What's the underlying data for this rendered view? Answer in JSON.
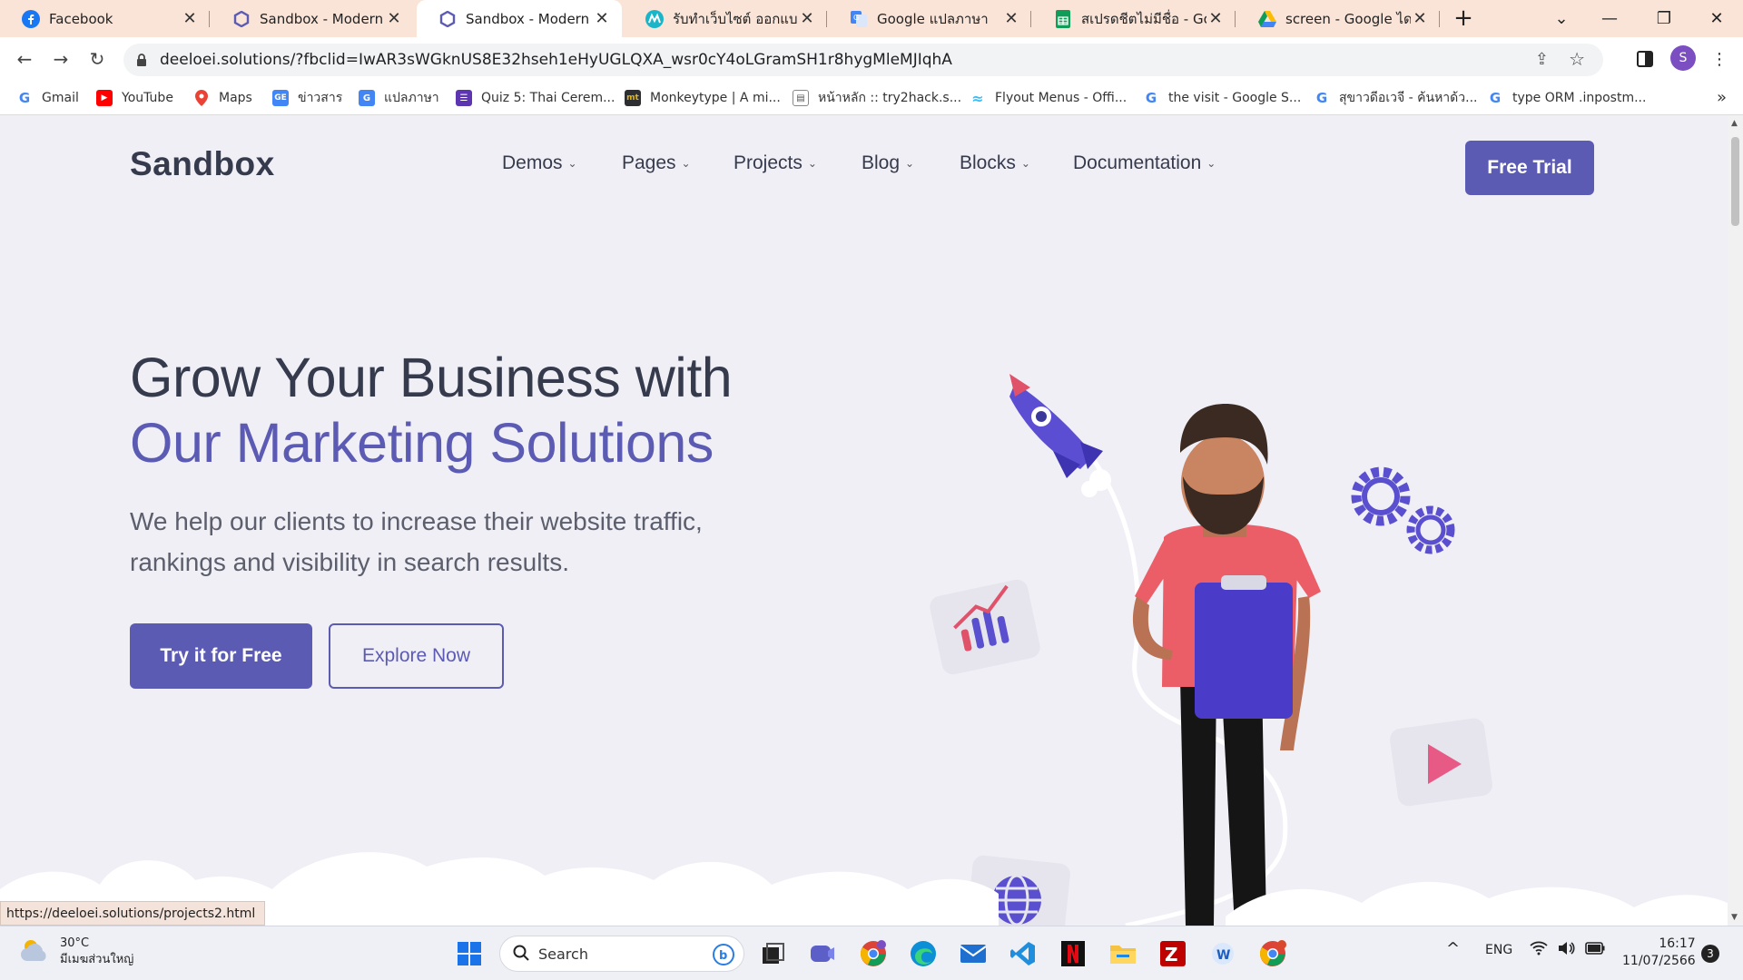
{
  "browser": {
    "tabs": [
      {
        "title": "Facebook",
        "icon": "facebook-icon"
      },
      {
        "title": "Sandbox - Modern &",
        "icon": "sandbox-icon"
      },
      {
        "title": "Sandbox - Modern &",
        "icon": "sandbox-icon",
        "active": true
      },
      {
        "title": "รับทำเว็บไซต์ ออกแบบเว็บ",
        "icon": "web-agency-icon"
      },
      {
        "title": "Google แปลภาษา",
        "icon": "google-translate-icon"
      },
      {
        "title": "สเปรดชีตไม่มีชื่อ - Goog",
        "icon": "google-sheets-icon"
      },
      {
        "title": "screen - Google ไดรฟ์",
        "icon": "google-drive-icon"
      }
    ],
    "url": "deeloei.solutions/?fbclid=IwAR3sWGknUS8E32hseh1eHyUGLQXA_wsr0cY4oLGramSH1r8hygMleMJIqhA",
    "profile_initial": "S",
    "bookmarks": [
      {
        "label": "Gmail",
        "icon": "google-icon"
      },
      {
        "label": "YouTube",
        "icon": "youtube-icon"
      },
      {
        "label": "Maps",
        "icon": "maps-icon"
      },
      {
        "label": "ข่าวสาร",
        "icon": "news-icon"
      },
      {
        "label": "แปลภาษา",
        "icon": "translate-icon"
      },
      {
        "label": "Quiz 5: Thai Cerem...",
        "icon": "quiz-icon"
      },
      {
        "label": "Monkeytype | A mi...",
        "icon": "monkeytype-icon"
      },
      {
        "label": "หน้าหลัก :: try2hack.s...",
        "icon": "try2hack-icon"
      },
      {
        "label": "Flyout Menus - Offi...",
        "icon": "tailwind-icon"
      },
      {
        "label": "the visit - Google S...",
        "icon": "google-icon"
      },
      {
        "label": "สุขาวดีอเวจี - ค้นหาด้ว...",
        "icon": "google-icon"
      },
      {
        "label": "type ORM .inpostm...",
        "icon": "google-icon"
      }
    ],
    "status_url": "https://deeloei.solutions/projects2.html"
  },
  "site": {
    "logo": "Sandbox",
    "nav": [
      "Demos",
      "Pages",
      "Projects",
      "Blog",
      "Blocks",
      "Documentation"
    ],
    "cta": "Free Trial",
    "hero": {
      "line1": "Grow Your Business with",
      "line2": "Our Marketing Solutions",
      "subtitle": "We help our clients to increase their website traffic, rankings and visibility in search results.",
      "primary_button": "Try it for Free",
      "secondary_button": "Explore Now"
    },
    "colors": {
      "brand": "#5c5bb4",
      "heading": "#353b4c",
      "background": "#f0eff6"
    }
  },
  "taskbar": {
    "weather_temp": "30°C",
    "weather_desc": "มีเมฆส่วนใหญ่",
    "search_placeholder": "Search",
    "language": "ENG",
    "time": "16:17",
    "date": "11/07/2566",
    "notifications": "3"
  }
}
